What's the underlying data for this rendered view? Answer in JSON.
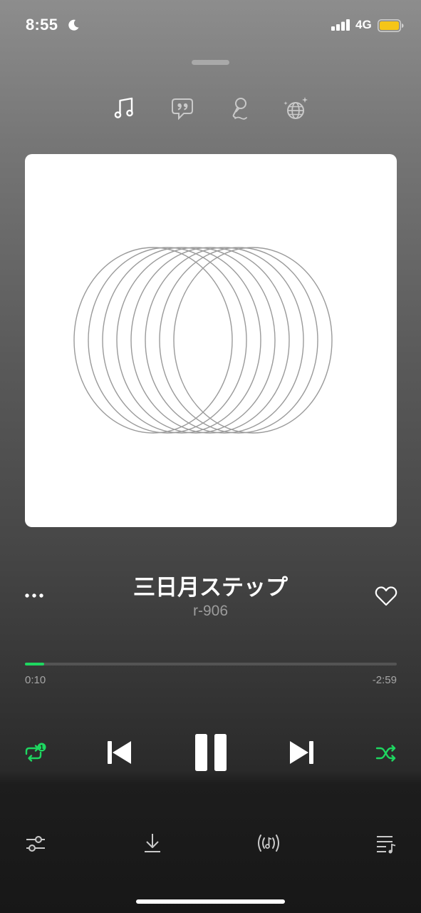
{
  "status_bar": {
    "time": "8:55",
    "network": "4G",
    "battery_color": "#f5c518"
  },
  "tabs": [
    {
      "name": "song",
      "icon": "music-note-icon",
      "active": true
    },
    {
      "name": "lyrics",
      "icon": "quote-bubble-icon",
      "active": false
    },
    {
      "name": "karaoke",
      "icon": "microphone-icon",
      "active": false
    },
    {
      "name": "social",
      "icon": "globe-sparkle-icon",
      "active": false
    }
  ],
  "track": {
    "title": "三日月ステップ",
    "artist": "r-906"
  },
  "playback": {
    "elapsed": "0:10",
    "remaining": "-2:59",
    "progress": 0.052,
    "repeat_badge": "1",
    "state": "playing"
  },
  "colors": {
    "accent": "#1ed760",
    "artwork_stroke": "#9a9a9a"
  },
  "bottom_bar": [
    {
      "name": "equalizer",
      "icon": "sliders-icon"
    },
    {
      "name": "download",
      "icon": "download-icon"
    },
    {
      "name": "broadcast",
      "icon": "sound-wave-note-icon"
    },
    {
      "name": "queue",
      "icon": "playlist-icon"
    }
  ]
}
